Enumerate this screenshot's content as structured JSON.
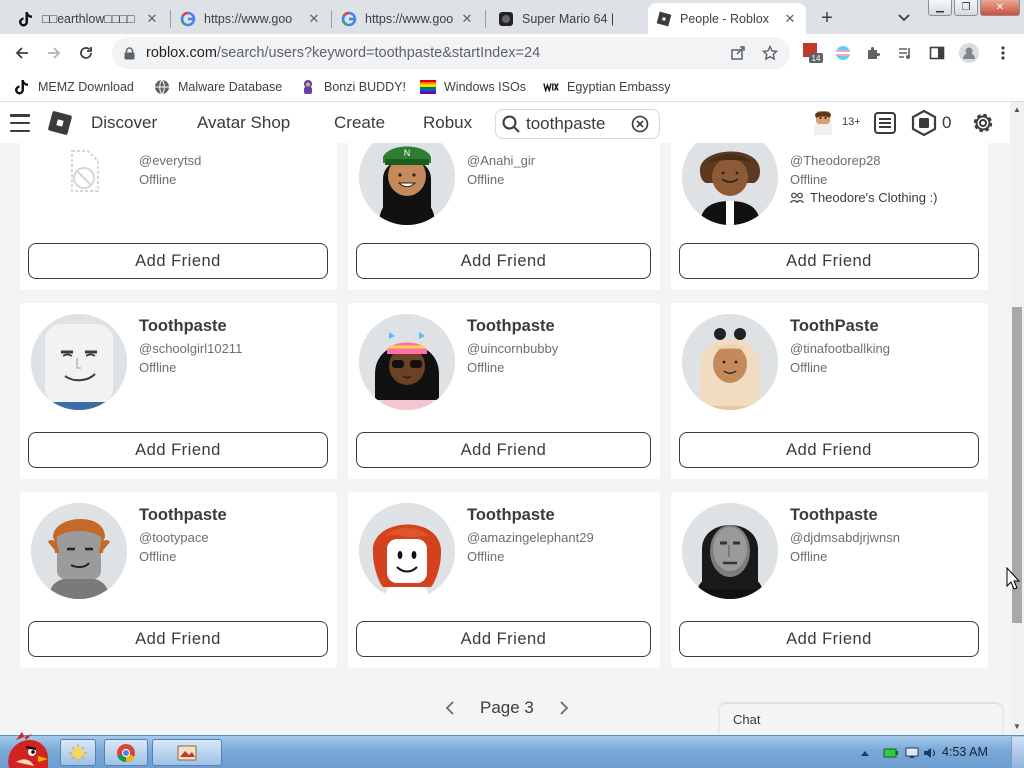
{
  "browser": {
    "tabs": [
      {
        "title": "□□earthlow□□□□",
        "icon": "tiktok-icon",
        "active": false
      },
      {
        "title": "https://www.goo",
        "icon": "google-icon",
        "active": false
      },
      {
        "title": "https://www.goo",
        "icon": "google-icon",
        "active": false
      },
      {
        "title": "Super Mario 64 |",
        "icon": "mario-icon",
        "active": false
      },
      {
        "title": "People - Roblox",
        "icon": "roblox-icon",
        "active": true
      }
    ],
    "url_host": "roblox.com",
    "url_path": "/search/users?keyword=toothpaste&startIndex=24",
    "extension_badge": "14",
    "bookmarks": [
      {
        "label": "MEMZ Download",
        "icon": "tiktok-icon"
      },
      {
        "label": "Malware Database",
        "icon": "globe-icon"
      },
      {
        "label": "Bonzi BUDDY!",
        "icon": "bonzi-icon"
      },
      {
        "label": "Windows ISOs",
        "icon": "rainbow-flag-icon"
      },
      {
        "label": "Egyptian Embassy",
        "icon": "wix-icon"
      }
    ]
  },
  "roblox": {
    "nav": {
      "discover": "Discover",
      "avatar_shop": "Avatar Shop",
      "create": "Create",
      "robux": "Robux"
    },
    "search_value": "toothpaste",
    "age_badge": "13+",
    "robux_count": "0",
    "add_friend_label": "Add Friend",
    "page_label": "Page 3",
    "chat_label": "Chat",
    "users": [
      {
        "name": "",
        "handle": "@everytsd",
        "status": "Offline",
        "group": ""
      },
      {
        "name": "",
        "handle": "@Anahi_gir",
        "status": "Offline",
        "group": ""
      },
      {
        "name": "",
        "handle": "@Theodorep28",
        "status": "Offline",
        "group": "Theodore's Clothing :)"
      },
      {
        "name": "Toothpaste",
        "handle": "@schoolgirl10211",
        "status": "Offline",
        "group": ""
      },
      {
        "name": "Toothpaste",
        "handle": "@uincornbubby",
        "status": "Offline",
        "group": ""
      },
      {
        "name": "ToothPaste",
        "handle": "@tinafootballking",
        "status": "Offline",
        "group": ""
      },
      {
        "name": "Toothpaste",
        "handle": "@tootypace",
        "status": "Offline",
        "group": ""
      },
      {
        "name": "Toothpaste",
        "handle": "@amazingelephant29",
        "status": "Offline",
        "group": ""
      },
      {
        "name": "Toothpaste",
        "handle": "@djdmsabdjrjwnsn",
        "status": "Offline",
        "group": ""
      }
    ]
  },
  "taskbar": {
    "time": "4:53 AM"
  },
  "colors": {
    "roblox_text": "#393b3d",
    "roblox_muted": "#6b6e70",
    "page_bg": "#f2f4f5",
    "chrome_tabstrip": "#dee1e6"
  }
}
